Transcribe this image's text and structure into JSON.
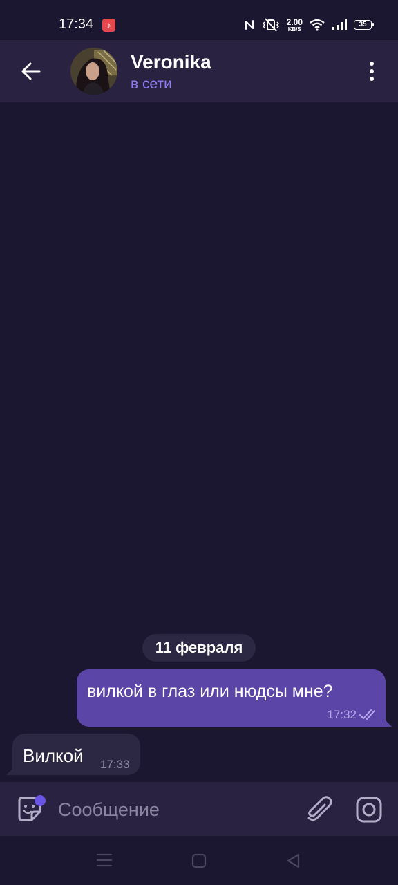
{
  "status_bar": {
    "time": "17:34",
    "speed_value": "2.00",
    "speed_unit": "KB/S",
    "battery": "35",
    "icons": [
      "music-notification-icon",
      "nfc-icon",
      "vibrate-icon",
      "wifi-icon",
      "cellular-signal-icon",
      "battery-icon"
    ]
  },
  "header": {
    "contact_name": "Veronika",
    "contact_status": "в сети"
  },
  "chat": {
    "date_separator": "11 февраля",
    "messages": [
      {
        "direction": "outgoing",
        "text": "вилкой в глаз или нюдсы мне?",
        "time": "17:32",
        "read": true
      },
      {
        "direction": "incoming",
        "text": "Вилкой",
        "time": "17:33"
      }
    ]
  },
  "composer": {
    "placeholder": "Сообщение"
  },
  "colors": {
    "background": "#1b1730",
    "header": "#292341",
    "accent": "#8e7cf6",
    "outgoing_bubble": "#5b46a8",
    "incoming_bubble": "#2c2742"
  }
}
